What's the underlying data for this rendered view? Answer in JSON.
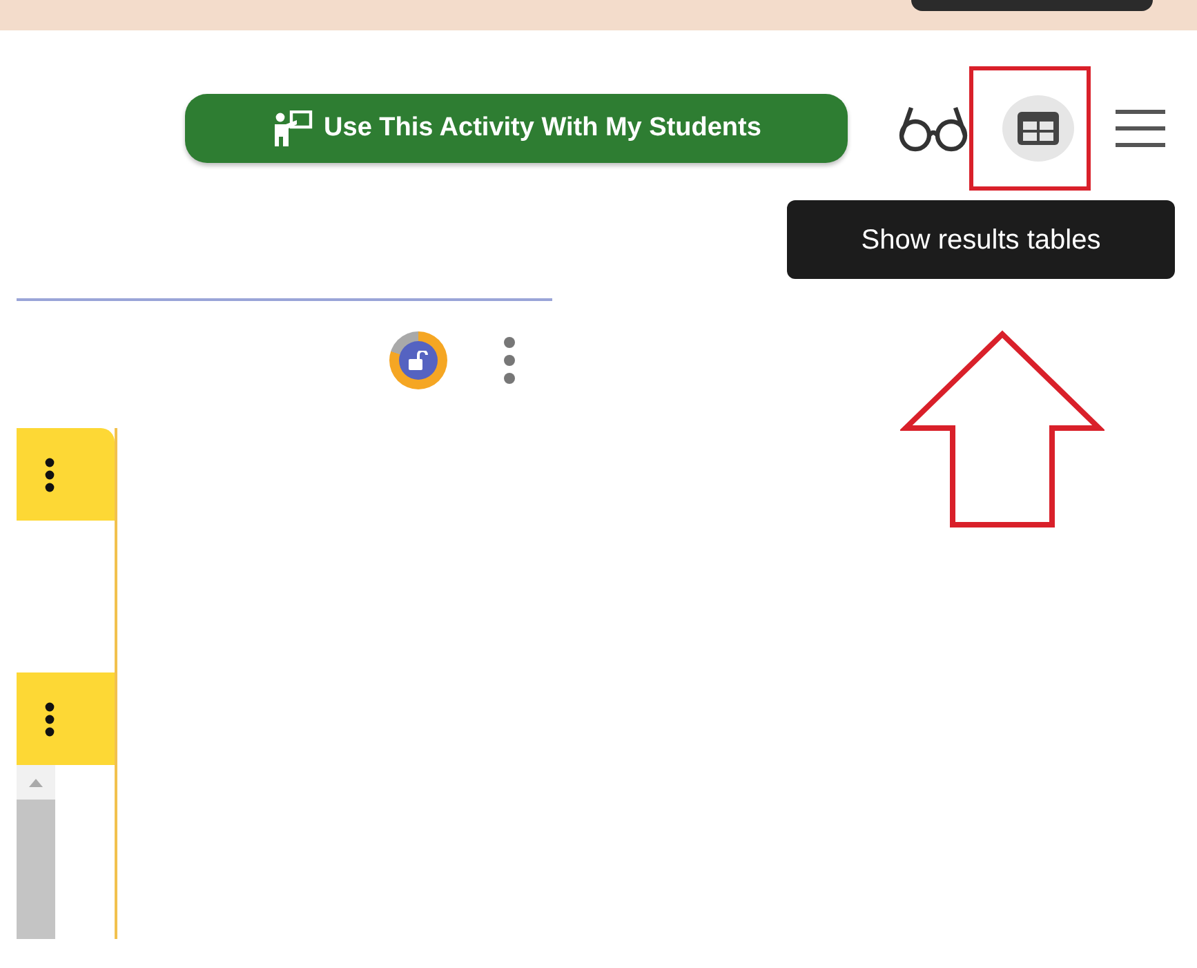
{
  "toolbar": {
    "activity_button": "Use This Activity With My Students",
    "results_table_button": {
      "hovered": true
    },
    "tooltip": "Show results tables"
  }
}
